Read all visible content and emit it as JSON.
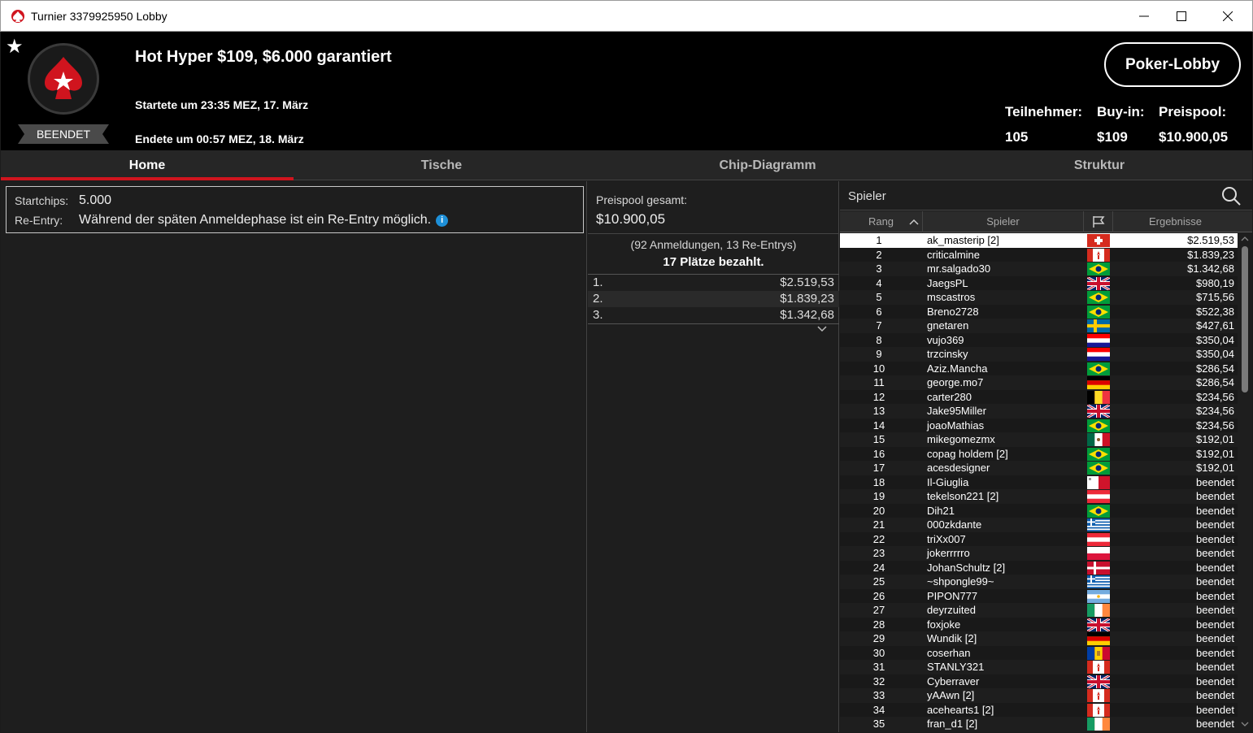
{
  "window": {
    "title": "Turnier 3379925950 Lobby"
  },
  "header": {
    "status_badge": "BEENDET",
    "tournament_name": "Hot Hyper $109, $6.000 garantiert",
    "started": "Startete um 23:35 MEZ, 17. März",
    "ended": "Endete um 00:57 MEZ, 18. März",
    "lobby_button": "Poker-Lobby",
    "stats": {
      "players_label": "Teilnehmer:",
      "players_value": "105",
      "buyin_label": "Buy-in:",
      "buyin_value": "$109",
      "prizepool_label": "Preispool:",
      "prizepool_value": "$10.900,05"
    }
  },
  "tabs": [
    "Home",
    "Tische",
    "Chip-Diagramm",
    "Struktur"
  ],
  "home": {
    "startchips_label": "Startchips:",
    "startchips_value": "5.000",
    "reentry_label": "Re-Entry:",
    "reentry_value": "Während der späten Anmeldephase ist ein Re-Entry möglich."
  },
  "prizepool": {
    "label": "Preispool gesamt:",
    "value": "$10.900,05",
    "entries": "(92 Anmeldungen, 13 Re-Entrys)",
    "paid": "17 Plätze bezahlt.",
    "payouts": [
      {
        "place": "1.",
        "amount": "$2.519,53"
      },
      {
        "place": "2.",
        "amount": "$1.839,23"
      },
      {
        "place": "3.",
        "amount": "$1.342,68"
      }
    ]
  },
  "players": {
    "search_placeholder": "Spieler",
    "headers": {
      "rank": "Rang",
      "player": "Spieler",
      "results": "Ergebnisse"
    },
    "rows": [
      {
        "rank": "1",
        "name": "ak_masterip [2]",
        "flag": "ch",
        "result": "$2.519,53"
      },
      {
        "rank": "2",
        "name": "criticalmine",
        "flag": "ca",
        "result": "$1.839,23"
      },
      {
        "rank": "3",
        "name": "mr.salgado30",
        "flag": "br",
        "result": "$1.342,68"
      },
      {
        "rank": "4",
        "name": "JaegsPL",
        "flag": "gb",
        "result": "$980,19"
      },
      {
        "rank": "5",
        "name": "mscastros",
        "flag": "br",
        "result": "$715,56"
      },
      {
        "rank": "6",
        "name": "Breno2728",
        "flag": "br",
        "result": "$522,38"
      },
      {
        "rank": "7",
        "name": "gnetaren",
        "flag": "se",
        "result": "$427,61"
      },
      {
        "rank": "8",
        "name": "vujo369",
        "flag": "hr",
        "result": "$350,04"
      },
      {
        "rank": "9",
        "name": "trzcinsky",
        "flag": "hr",
        "result": "$350,04"
      },
      {
        "rank": "10",
        "name": "Aziz.Mancha",
        "flag": "br",
        "result": "$286,54"
      },
      {
        "rank": "11",
        "name": "george.mo7",
        "flag": "de",
        "result": "$286,54"
      },
      {
        "rank": "12",
        "name": "carter280",
        "flag": "be",
        "result": "$234,56"
      },
      {
        "rank": "13",
        "name": "Jake95Miller",
        "flag": "gb",
        "result": "$234,56"
      },
      {
        "rank": "14",
        "name": "joaoMathias",
        "flag": "br",
        "result": "$234,56"
      },
      {
        "rank": "15",
        "name": "mikegomezmx",
        "flag": "mx",
        "result": "$192,01"
      },
      {
        "rank": "16",
        "name": "copag holdem [2]",
        "flag": "br",
        "result": "$192,01"
      },
      {
        "rank": "17",
        "name": "acesdesigner",
        "flag": "br",
        "result": "$192,01"
      },
      {
        "rank": "18",
        "name": "Il-Giuglia",
        "flag": "mt",
        "result": "beendet"
      },
      {
        "rank": "19",
        "name": "tekelson221 [2]",
        "flag": "at",
        "result": "beendet"
      },
      {
        "rank": "20",
        "name": "Dih21",
        "flag": "br",
        "result": "beendet"
      },
      {
        "rank": "21",
        "name": "000zkdante",
        "flag": "gr",
        "result": "beendet"
      },
      {
        "rank": "22",
        "name": "triXx007",
        "flag": "at",
        "result": "beendet"
      },
      {
        "rank": "23",
        "name": "jokerrrrro",
        "flag": "pl",
        "result": "beendet"
      },
      {
        "rank": "24",
        "name": "JohanSchultz [2]",
        "flag": "dk",
        "result": "beendet"
      },
      {
        "rank": "25",
        "name": "~shpongle99~",
        "flag": "gr",
        "result": "beendet"
      },
      {
        "rank": "26",
        "name": "PIPON777",
        "flag": "ar",
        "result": "beendet"
      },
      {
        "rank": "27",
        "name": "deyrzuited",
        "flag": "ie",
        "result": "beendet"
      },
      {
        "rank": "28",
        "name": "foxjoke",
        "flag": "gb",
        "result": "beendet"
      },
      {
        "rank": "29",
        "name": "Wundik [2]",
        "flag": "de",
        "result": "beendet"
      },
      {
        "rank": "30",
        "name": "coserhan",
        "flag": "md",
        "result": "beendet"
      },
      {
        "rank": "31",
        "name": "STANLY321",
        "flag": "ca",
        "result": "beendet"
      },
      {
        "rank": "32",
        "name": "Cyberraver",
        "flag": "gb",
        "result": "beendet"
      },
      {
        "rank": "33",
        "name": "yAAwn [2]",
        "flag": "ca",
        "result": "beendet"
      },
      {
        "rank": "34",
        "name": "acehearts1 [2]",
        "flag": "ca",
        "result": "beendet"
      },
      {
        "rank": "35",
        "name": "fran_d1 [2]",
        "flag": "ie",
        "result": "beendet"
      }
    ]
  }
}
